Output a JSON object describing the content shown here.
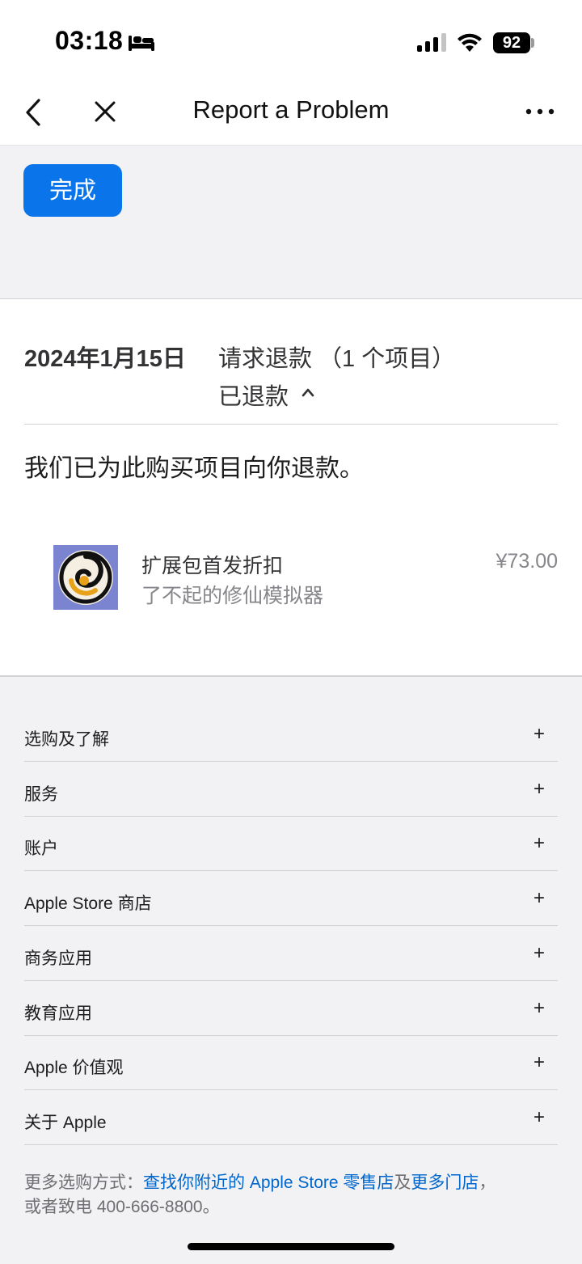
{
  "status_bar": {
    "time": "03:18",
    "battery": "92"
  },
  "nav": {
    "title": "Report a Problem"
  },
  "done_button": "完成",
  "order": {
    "date": "2024年1月15日",
    "type": "请求退款 （1 个项目）",
    "status": "已退款",
    "message": "我们已为此购买项目向你退款。",
    "item": {
      "name": "扩展包首发折扣",
      "app": "了不起的修仙模拟器",
      "price": "¥73.00"
    }
  },
  "footer": {
    "sections": [
      "选购及了解",
      "服务",
      "账户",
      "Apple Store 商店",
      "商务应用",
      "教育应用",
      "Apple 价值观",
      "关于 Apple"
    ],
    "expand_symbol": "+",
    "note": {
      "prefix": "更多选购方式：",
      "link1": "查找你附近的 Apple Store 零售店",
      "mid": "及",
      "link2": "更多门店",
      "suffix": "，",
      "line2": "或者致电 400-666-8800。"
    }
  }
}
